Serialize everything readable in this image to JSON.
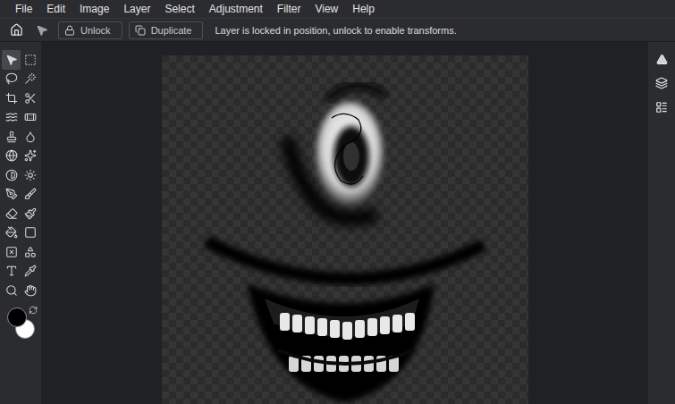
{
  "menu": [
    "File",
    "Edit",
    "Image",
    "Layer",
    "Select",
    "Adjustment",
    "Filter",
    "View",
    "Help"
  ],
  "options_bar": {
    "buttons": [
      {
        "label": "Unlock"
      },
      {
        "label": "Duplicate"
      }
    ],
    "message": "Layer is locked in position, unlock to enable transforms."
  },
  "tools": [
    {
      "selected": true
    },
    {
      "selected": false
    },
    {
      "selected": false
    },
    {
      "selected": false
    },
    {
      "selected": false
    },
    {
      "selected": false
    },
    {
      "selected": false
    },
    {
      "selected": false
    },
    {
      "selected": false
    },
    {
      "selected": false
    },
    {
      "selected": false
    },
    {
      "selected": false
    },
    {
      "selected": false
    },
    {
      "selected": false
    },
    {
      "selected": false
    },
    {
      "selected": false
    },
    {
      "selected": false
    },
    {
      "selected": false
    },
    {
      "selected": false
    },
    {
      "selected": false
    },
    {
      "selected": false
    },
    {
      "selected": false
    },
    {
      "selected": false
    },
    {
      "selected": false
    },
    {
      "selected": false
    },
    {
      "selected": false
    }
  ],
  "colors": {
    "foreground": "#000000",
    "background": "#ffffff"
  }
}
